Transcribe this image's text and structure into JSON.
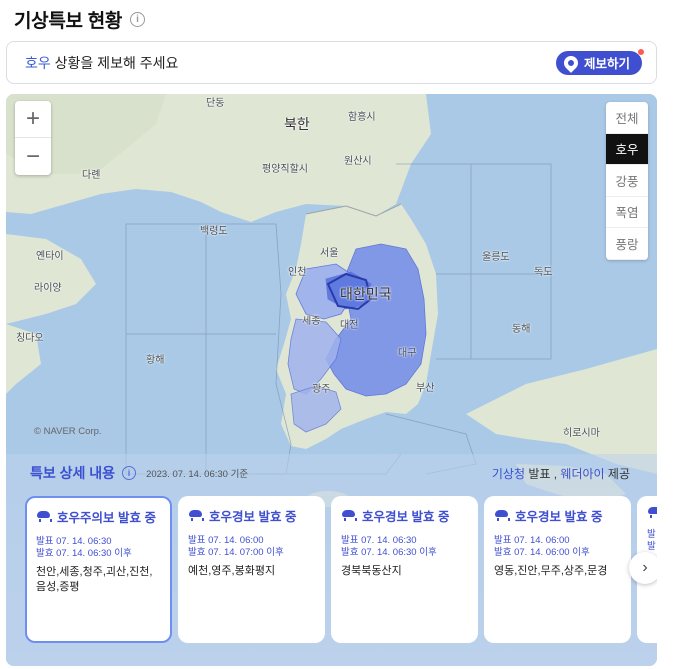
{
  "page": {
    "title": "기상특보 현황",
    "info_icon": "info-icon"
  },
  "report": {
    "highlight": "호우",
    "text": " 상황을 제보해 주세요",
    "button_label": "제보하기",
    "button_icon": "map-pin-icon"
  },
  "map": {
    "zoom_in": "+",
    "zoom_out": "−",
    "filters": [
      {
        "label": "전체",
        "active": false
      },
      {
        "label": "호우",
        "active": true
      },
      {
        "label": "강풍",
        "active": false
      },
      {
        "label": "폭염",
        "active": false
      },
      {
        "label": "풍랑",
        "active": false
      }
    ],
    "labels": {
      "dandong": "단동",
      "bukhan": "북한",
      "hamheung": "함흥시",
      "dalian": "다롄",
      "pyongyang": "평양직할시",
      "wonsan": "원산시",
      "baengnyeong": "백령도",
      "seoul": "서울",
      "yantai": "옌타이",
      "incheon": "인천",
      "ulleungdo": "울릉도",
      "dokdo": "독도",
      "laiyang": "라이양",
      "daehanminguk": "대한민국",
      "sejong": "세종",
      "daejeon": "대전",
      "donghae": "동해",
      "qingdao": "칭다오",
      "hwanghae": "황해",
      "daegu": "대구",
      "gwangju": "광주",
      "busan": "부산",
      "hiroshima": "히로시마"
    },
    "copyright": "© NAVER Corp.",
    "colors": {
      "sea": "#a9c9e6",
      "land": "#dfe6d4",
      "warning_fill": "#7d94e8",
      "advisory_fill": "#9fb2ee",
      "accent": "#3f4fd0"
    }
  },
  "detail": {
    "title": "특보 상세 내용",
    "date": "2023. 07. 14. 06:30 기준",
    "source_org": "기상청",
    "source_mid": " 발표 , ",
    "source_provider": "웨더아이",
    "source_end": " 제공",
    "cards": [
      {
        "title": "호우주의보 발효 중",
        "issued": "발표 07. 14. 06:30",
        "effective": "발효 07. 14. 06:30 이후",
        "areas": "천안,세종,청주,괴산,진천,음성,증평",
        "selected": true
      },
      {
        "title": "호우경보 발효 중",
        "issued": "발표 07. 14. 06:00",
        "effective": "발효 07. 14. 07:00 이후",
        "areas": "예천,영주,봉화평지",
        "selected": false
      },
      {
        "title": "호우경보 발효 중",
        "issued": "발표 07. 14. 06:30",
        "effective": "발효 07. 14. 06:30 이후",
        "areas": "경북북동산지",
        "selected": false
      },
      {
        "title": "호우경보 발효 중",
        "issued": "발표 07. 14. 06:00",
        "effective": "발효 07. 14. 06:00 이후",
        "areas": "영동,진안,무주,상주,문경",
        "selected": false
      }
    ],
    "partial_card": {
      "issued_fragment": "발",
      "effective_fragment": "발"
    },
    "next_icon": "chevron-right-icon"
  }
}
